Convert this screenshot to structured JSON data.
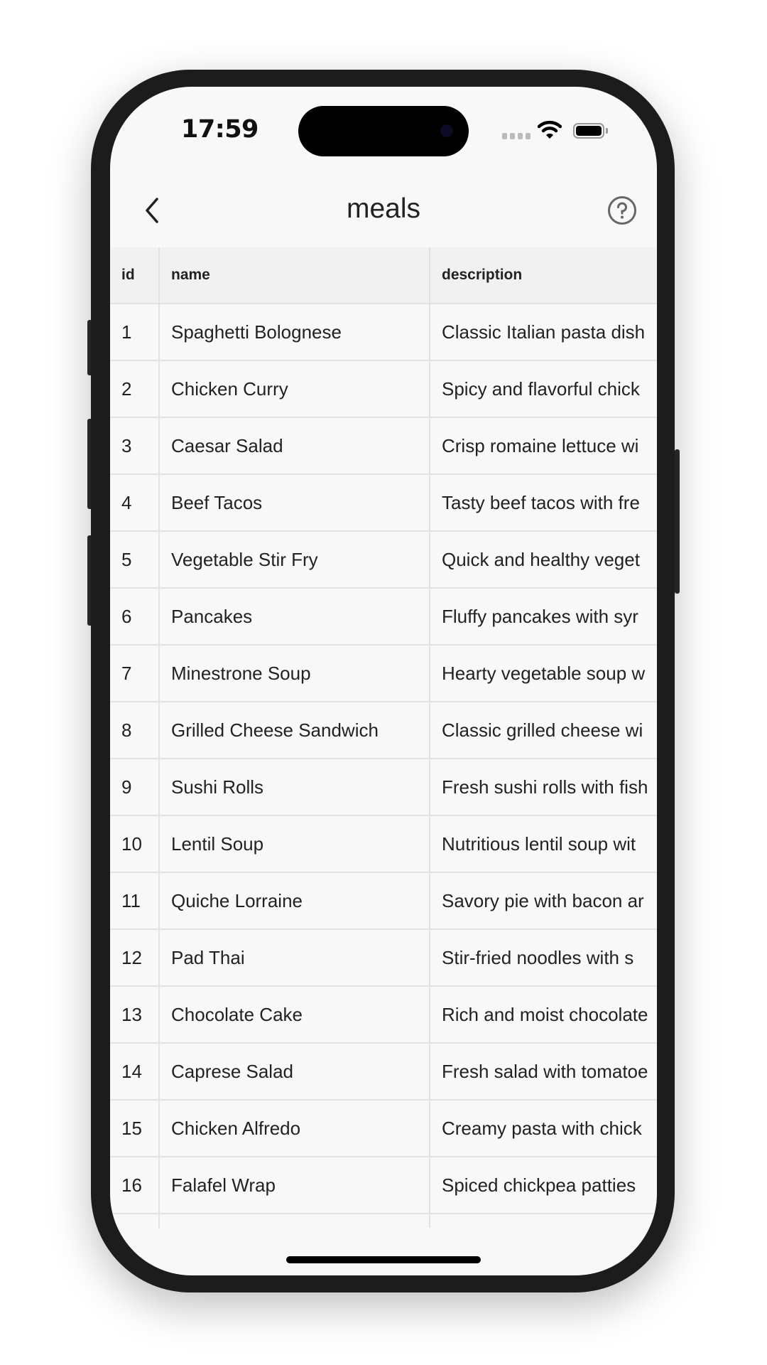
{
  "status_bar": {
    "time": "17:59",
    "signal_icon": "cellular-signal-icon",
    "wifi_icon": "wifi-icon",
    "battery_icon": "battery-icon"
  },
  "header": {
    "title": "meals",
    "back_icon": "chevron-left-icon",
    "help_icon": "help-circle-icon"
  },
  "table": {
    "columns": [
      "id",
      "name",
      "description"
    ],
    "rows": [
      {
        "id": "1",
        "name": "Spaghetti Bolognese",
        "description": "Classic Italian pasta dish"
      },
      {
        "id": "2",
        "name": "Chicken Curry",
        "description": "Spicy and flavorful chick"
      },
      {
        "id": "3",
        "name": "Caesar Salad",
        "description": "Crisp romaine lettuce wi"
      },
      {
        "id": "4",
        "name": "Beef Tacos",
        "description": "Tasty beef tacos with fre"
      },
      {
        "id": "5",
        "name": "Vegetable Stir Fry",
        "description": "Quick and healthy veget"
      },
      {
        "id": "6",
        "name": "Pancakes",
        "description": "Fluffy pancakes with syr"
      },
      {
        "id": "7",
        "name": "Minestrone Soup",
        "description": "Hearty vegetable soup w"
      },
      {
        "id": "8",
        "name": "Grilled Cheese Sandwich",
        "description": "Classic grilled cheese wi"
      },
      {
        "id": "9",
        "name": "Sushi Rolls",
        "description": "Fresh sushi rolls with fish"
      },
      {
        "id": "10",
        "name": "Lentil Soup",
        "description": "Nutritious lentil soup wit"
      },
      {
        "id": "11",
        "name": "Quiche Lorraine",
        "description": "Savory pie with bacon ar"
      },
      {
        "id": "12",
        "name": "Pad Thai",
        "description": "Stir-fried noodles with s"
      },
      {
        "id": "13",
        "name": "Chocolate Cake",
        "description": "Rich and moist chocolate"
      },
      {
        "id": "14",
        "name": "Caprese Salad",
        "description": "Fresh salad with tomatoe"
      },
      {
        "id": "15",
        "name": "Chicken Alfredo",
        "description": "Creamy pasta with chick"
      },
      {
        "id": "16",
        "name": "Falafel Wrap",
        "description": "Spiced chickpea patties"
      }
    ]
  }
}
